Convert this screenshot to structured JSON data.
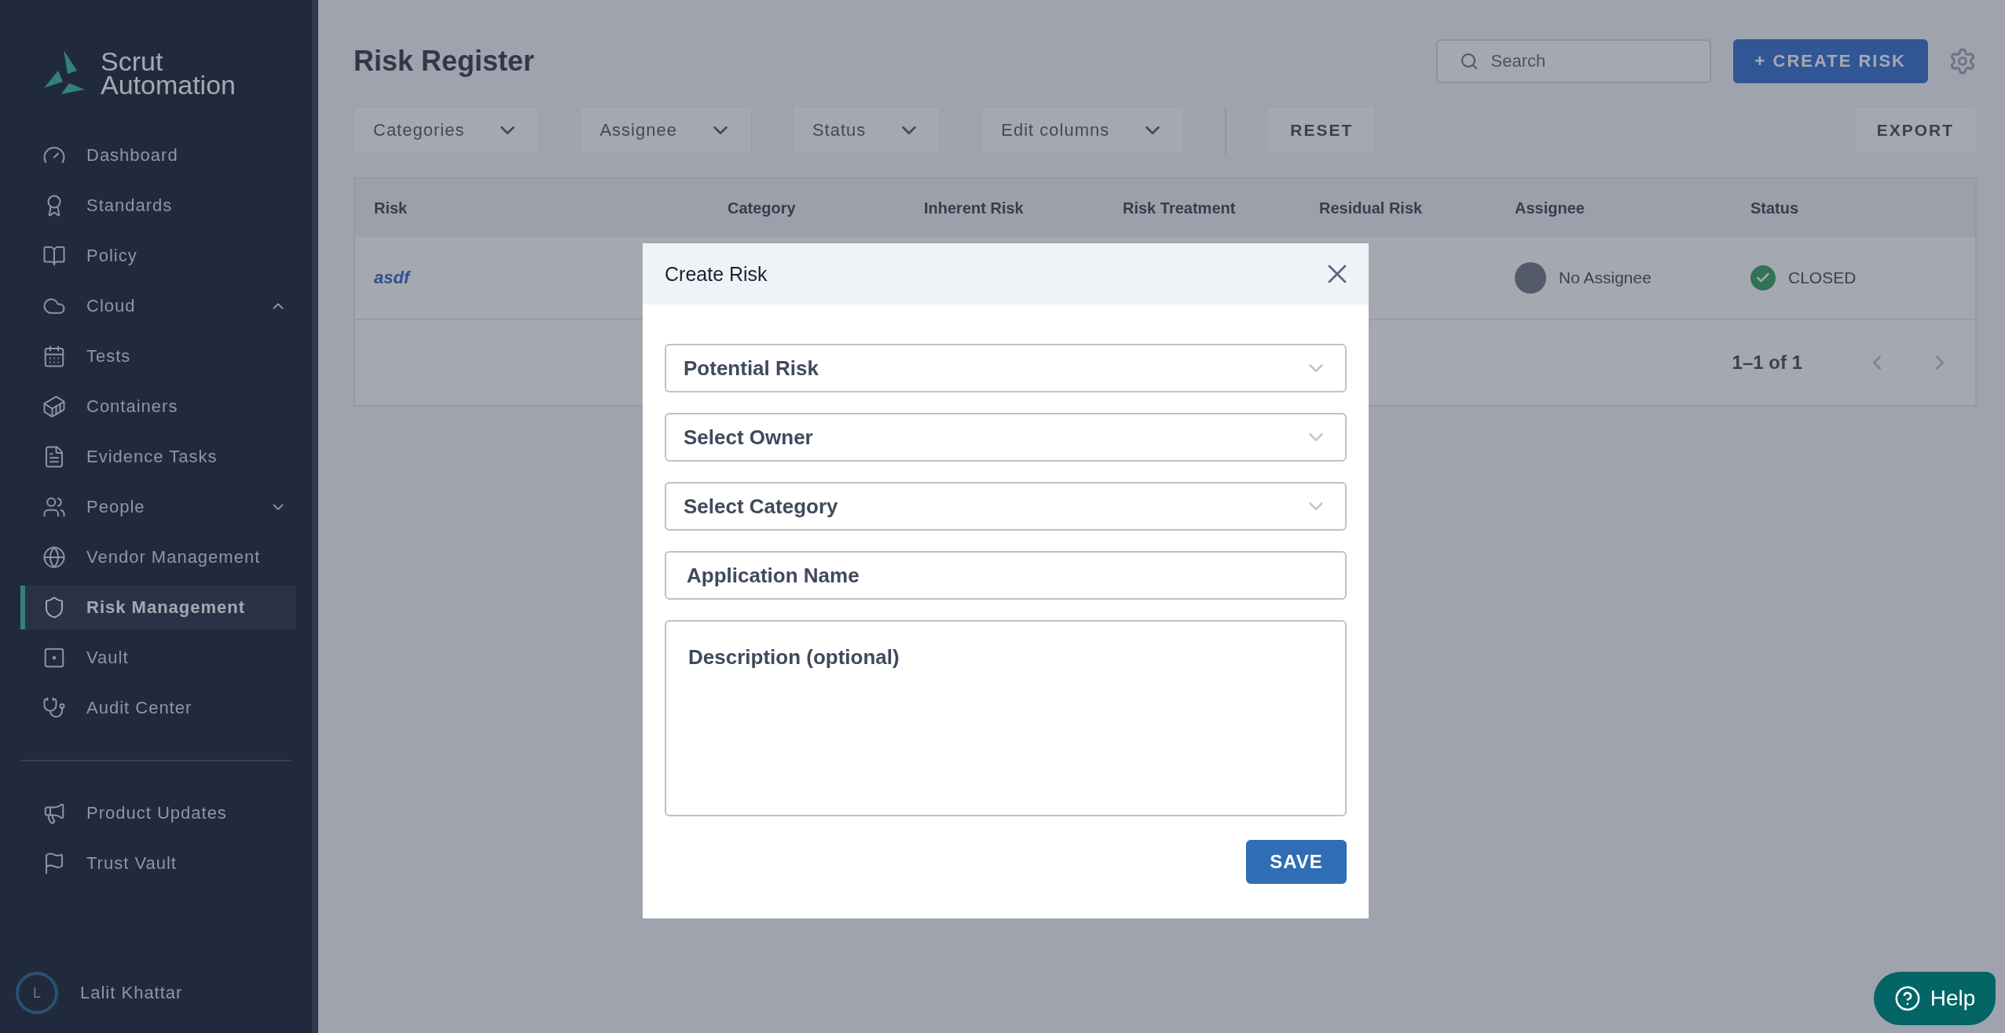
{
  "sidebar": {
    "logo": [
      "Scrut",
      "Automation"
    ],
    "items": [
      {
        "label": "Dashboard",
        "kind": "link",
        "selected": false
      },
      {
        "label": "Standards",
        "kind": "link",
        "selected": false
      },
      {
        "label": "Policy",
        "kind": "link",
        "selected": false
      },
      {
        "label": "Cloud",
        "kind": "group",
        "expanded": true,
        "selected": false
      },
      {
        "label": "Tests",
        "kind": "link",
        "selected": false
      },
      {
        "label": "Containers",
        "kind": "link",
        "selected": false
      },
      {
        "label": "Evidence Tasks",
        "kind": "link",
        "selected": false
      },
      {
        "label": "People",
        "kind": "group",
        "expanded": false,
        "selected": false
      },
      {
        "label": "Vendor Management",
        "kind": "link",
        "selected": false
      },
      {
        "label": "Risk Management",
        "kind": "link",
        "selected": true
      },
      {
        "label": "Vault",
        "kind": "link",
        "selected": false
      },
      {
        "label": "Audit Center",
        "kind": "link",
        "selected": false
      }
    ],
    "footer_items": [
      {
        "label": "Product Updates"
      },
      {
        "label": "Trust Vault"
      }
    ],
    "user": {
      "initial": "L",
      "name": "Lalit Khattar"
    }
  },
  "header": {
    "title": "Risk Register",
    "search": {
      "placeholder": "Search"
    },
    "create_button": "+ CREATE RISK"
  },
  "filters": [
    {
      "label": "Categories"
    },
    {
      "label": "Assignee"
    },
    {
      "label": "Status"
    },
    {
      "label": "Edit columns"
    }
  ],
  "reset_button": "RESET",
  "export_button": "EXPORT",
  "table": {
    "columns": [
      "Risk",
      "Category",
      "Inherent Risk",
      "Risk Treatment",
      "Residual Risk",
      "Assignee",
      "Status"
    ],
    "rows": [
      {
        "risk": "asdf",
        "assignee": "No Assignee",
        "status": "CLOSED"
      }
    ],
    "pagination": "1–1 of 1"
  },
  "modal": {
    "title": "Create Risk",
    "fields": [
      {
        "kind": "select",
        "placeholder": "Potential Risk"
      },
      {
        "kind": "select",
        "placeholder": "Select Owner"
      },
      {
        "kind": "select",
        "placeholder": "Select Category"
      },
      {
        "kind": "input",
        "placeholder": "Application Name"
      },
      {
        "kind": "textarea",
        "placeholder": "Description (optional)"
      }
    ],
    "save_button": "SAVE"
  },
  "help_button": "Help"
}
